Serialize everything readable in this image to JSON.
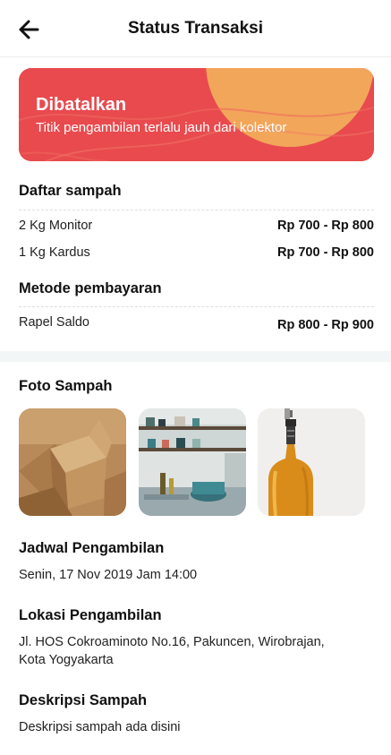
{
  "header": {
    "title": "Status Transaksi",
    "back_icon": "arrow-left-icon"
  },
  "status": {
    "title": "Dibatalkan",
    "reason": "Titik pengambilan terlalu jauh dari kolektor",
    "colors": {
      "base": "#E84A4E",
      "accent": "#F2A65A"
    }
  },
  "waste_list": {
    "title": "Daftar sampah",
    "items": [
      {
        "label": "2 Kg Monitor",
        "price": "Rp 700 - Rp 800"
      },
      {
        "label": "1 Kg Kardus",
        "price": "Rp 700 - Rp 800"
      }
    ]
  },
  "payment": {
    "title": "Metode pembayaran",
    "method": "Rapel Saldo",
    "price": "Rp 800 - Rp 900"
  },
  "photos": {
    "title": "Foto Sampah",
    "items": [
      "cardboard-boxes-photo",
      "kitchen-photo",
      "oil-bottle-photo"
    ]
  },
  "schedule": {
    "title": "Jadwal Pengambilan",
    "value": "Senin, 17 Nov 2019 Jam 14:00"
  },
  "location": {
    "title": "Lokasi Pengambilan",
    "line1": "Jl. HOS Cokroaminoto No.16, Pakuncen, Wirobrajan,",
    "line2": "Kota Yogyakarta"
  },
  "description": {
    "title": "Deskripsi Sampah",
    "value": "Deskripsi sampah ada disini"
  }
}
